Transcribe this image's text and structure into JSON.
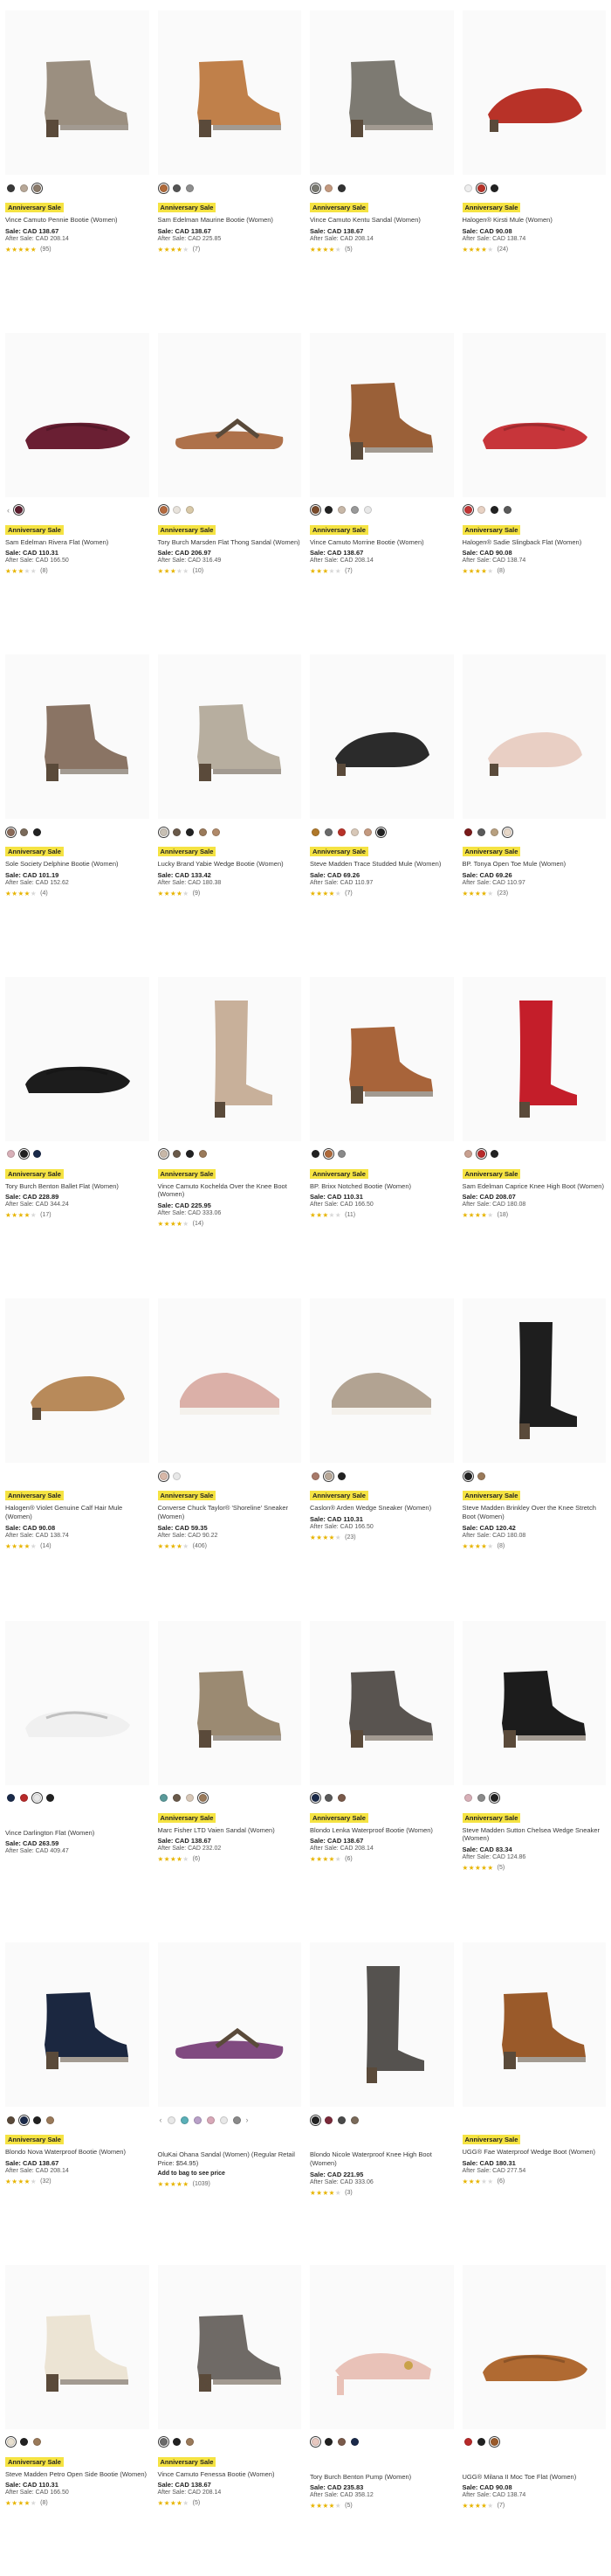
{
  "colors": {
    "accent_badge": "#f5e342",
    "star": "#e7b400"
  },
  "products": [
    {
      "badge": "Anniversary Sale",
      "title": "Vince Camuto Pennie Bootie (Women)",
      "sale": "Sale: CAD 138.67",
      "after": "After Sale: CAD 208.14",
      "rating": 5,
      "reviews": "(95)",
      "swatches": [
        "#3a3a3a",
        "#b8a898",
        "#8a7a6a"
      ],
      "selected": 2,
      "shape": "bootie",
      "color": "#9b8f80"
    },
    {
      "badge": "Anniversary Sale",
      "title": "Sam Edelman Maurine Bootie (Women)",
      "sale": "Sale: CAD 138.67",
      "after": "After Sale: CAD 225.85",
      "rating": 4,
      "reviews": "(7)",
      "swatches": [
        "#b06a3a",
        "#555555",
        "#8f8f8f"
      ],
      "selected": 0,
      "shape": "bootie",
      "color": "#c0804a"
    },
    {
      "badge": "Anniversary Sale",
      "title": "Vince Camuto Kentu Sandal (Women)",
      "sale": "Sale: CAD 138.67",
      "after": "After Sale: CAD 208.14",
      "rating": 4,
      "reviews": "(5)",
      "swatches": [
        "#7a7a72",
        "#c49a80",
        "#333333"
      ],
      "selected": 0,
      "shape": "bootie",
      "color": "#7d7a72"
    },
    {
      "badge": "Anniversary Sale",
      "title": "Halogen® Kirsti Mule (Women)",
      "sale": "Sale: CAD 90.08",
      "after": "After Sale: CAD 138.74",
      "rating": 4,
      "reviews": "(24)",
      "swatches": [
        "#eeeeee",
        "#b83228",
        "#222222"
      ],
      "selected": 1,
      "shape": "mule",
      "color": "#b83228"
    },
    {
      "badge": "Anniversary Sale",
      "title": "Sam Edelman Rivera Flat (Women)",
      "sale": "Sale: CAD 110.31",
      "after": "After Sale: CAD 166.50",
      "rating": 3,
      "reviews": "(8)",
      "swatches": [
        "#5c1d2e"
      ],
      "selected": 0,
      "shape": "flat",
      "color": "#6a1f33",
      "prev": true
    },
    {
      "badge": "Anniversary Sale",
      "title": "Tory Burch Marsden Flat Thong Sandal (Women)",
      "sale": "Sale: CAD 206.97",
      "after": "After Sale: CAD 316.49",
      "rating": 3,
      "reviews": "(10)",
      "swatches": [
        "#b56a3e",
        "#e8e3dc",
        "#d9c9a8"
      ],
      "selected": 0,
      "shape": "sandal",
      "color": "#a0582a"
    },
    {
      "badge": "Anniversary Sale",
      "title": "Vince Camuto Morrine Bootie (Women)",
      "sale": "Sale: CAD 138.67",
      "after": "After Sale: CAD 208.14",
      "rating": 3,
      "reviews": "(7)",
      "swatches": [
        "#7a4a2a",
        "#222222",
        "#c8b8a8",
        "#999999",
        "#e8e8e8"
      ],
      "selected": 0,
      "shape": "bootie",
      "color": "#9a6038"
    },
    {
      "badge": "Anniversary Sale",
      "title": "Halogen® Sadie Slingback Flat (Women)",
      "sale": "Sale: CAD 90.08",
      "after": "After Sale: CAD 138.74",
      "rating": 4,
      "reviews": "(8)",
      "swatches": [
        "#c23434",
        "#e8d2c4",
        "#222222",
        "#5a5a5a"
      ],
      "selected": 0,
      "shape": "flat",
      "color": "#c7353a"
    },
    {
      "badge": "Anniversary Sale",
      "title": "Sole Society Delphine Bootie (Women)",
      "sale": "Sale: CAD 101.19",
      "after": "After Sale: CAD 152.62",
      "rating": 4,
      "reviews": "(4)",
      "swatches": [
        "#8a6a58",
        "#7a6a5a",
        "#222222"
      ],
      "selected": 0,
      "shape": "bootie",
      "color": "#8a7464"
    },
    {
      "badge": "Anniversary Sale",
      "title": "Lucky Brand Yabie Wedge Bootie (Women)",
      "sale": "Sale: CAD 133.42",
      "after": "After Sale: CAD 180.38",
      "rating": 4,
      "reviews": "(9)",
      "swatches": [
        "#c8c0b4",
        "#6a5a4a",
        "#222222",
        "#9a7a5a",
        "#b08a6a"
      ],
      "selected": 0,
      "shape": "bootie",
      "color": "#b7ae9f"
    },
    {
      "badge": "Anniversary Sale",
      "title": "Steve Madden Trace Studded Mule (Women)",
      "sale": "Sale: CAD 69.26",
      "after": "After Sale: CAD 110.97",
      "rating": 4,
      "reviews": "(7)",
      "swatches": [
        "#b0782a",
        "#6a6a6a",
        "#b83228",
        "#d8c8b8",
        "#c49a80",
        "#222222"
      ],
      "selected": 5,
      "shape": "mule",
      "color": "#2b2b2b"
    },
    {
      "badge": "Anniversary Sale",
      "title": "BP. Tonya Open Toe Mule (Women)",
      "sale": "Sale: CAD 69.26",
      "after": "After Sale: CAD 110.97",
      "rating": 4,
      "reviews": "(23)",
      "swatches": [
        "#7a1a1a",
        "#5a5a5a",
        "#b8a080",
        "#e8d8c8"
      ],
      "selected": 3,
      "shape": "mule",
      "color": "#e9cfc4"
    },
    {
      "badge": "Anniversary Sale",
      "title": "Tory Burch Benton Ballet Flat (Women)",
      "sale": "Sale: CAD 228.89",
      "after": "After Sale: CAD 344.24",
      "rating": 4,
      "reviews": "(17)",
      "swatches": [
        "#d8b0b8",
        "#222222",
        "#1a2a4a"
      ],
      "selected": 1,
      "shape": "flat",
      "color": "#1c1c1c"
    },
    {
      "badge": "Anniversary Sale",
      "title": "Vince Camuto Kochelda Over the Knee Boot (Women)",
      "sale": "Sale: CAD 225.95",
      "after": "After Sale: CAD 333.06",
      "rating": 4,
      "reviews": "(14)",
      "swatches": [
        "#c8b8a8",
        "#6a5a4a",
        "#222222",
        "#9a7a5a"
      ],
      "selected": 0,
      "shape": "tallboot",
      "color": "#c8b09a"
    },
    {
      "badge": "Anniversary Sale",
      "title": "BP. Brixx Notched Bootie (Women)",
      "sale": "Sale: CAD 110.31",
      "after": "After Sale: CAD 166.50",
      "rating": 3,
      "reviews": "(11)",
      "swatches": [
        "#222222",
        "#b06a3a",
        "#8a8a8a"
      ],
      "selected": 1,
      "shape": "bootie",
      "color": "#a8643a"
    },
    {
      "badge": "Anniversary Sale",
      "title": "Sam Edelman Caprice Knee High Boot (Women)",
      "sale": "Sale: CAD 208.07",
      "after": "After Sale: CAD 180.08",
      "rating": 4,
      "reviews": "(18)",
      "swatches": [
        "#c8a090",
        "#b82a2a",
        "#222222"
      ],
      "selected": 1,
      "shape": "tallboot",
      "color": "#c41e2a"
    },
    {
      "badge": "Anniversary Sale",
      "title": "Halogen® Violet Genuine Calf Hair Mule (Women)",
      "sale": "Sale: CAD 90.08",
      "after": "After Sale: CAD 138.74",
      "rating": 4,
      "reviews": "(14)",
      "swatches": [],
      "selected": -1,
      "shape": "mule",
      "color": "#b88a5a"
    },
    {
      "badge": "Anniversary Sale",
      "title": "Converse Chuck Taylor® 'Shoreline' Sneaker (Women)",
      "sale": "Sale: CAD 59.35",
      "after": "After Sale: CAD 90.22",
      "rating": 4,
      "reviews": "(406)",
      "swatches": [
        "#d8b8a8",
        "#e8e8e8"
      ],
      "selected": 0,
      "shape": "sneaker",
      "color": "#dbb0a8"
    },
    {
      "badge": "Anniversary Sale",
      "title": "Caslon® Arden Wedge Sneaker (Women)",
      "sale": "Sale: CAD 110.31",
      "after": "After Sale: CAD 166.50",
      "rating": 4,
      "reviews": "(23)",
      "swatches": [
        "#a87a6a",
        "#b8a898",
        "#222222"
      ],
      "selected": 1,
      "shape": "sneaker",
      "color": "#b2a392"
    },
    {
      "badge": "Anniversary Sale",
      "title": "Steve Madden Brinkley Over the Knee Stretch Boot (Women)",
      "sale": "Sale: CAD 120.42",
      "after": "After Sale: CAD 180.08",
      "rating": 4,
      "reviews": "(8)",
      "swatches": [
        "#222222",
        "#9a7a5a"
      ],
      "selected": 0,
      "shape": "tallboot",
      "color": "#1e1e1e"
    },
    {
      "badge": "",
      "title": "Vince Darlington Flat (Women)",
      "sale": "Sale: CAD 263.59",
      "after": "After Sale: CAD 409.47",
      "rating": 0,
      "reviews": "",
      "swatches": [
        "#1a2a4a",
        "#b82a2a",
        "#e8e8e8",
        "#222222"
      ],
      "selected": 2,
      "shape": "flat",
      "color": "#f0f0f0"
    },
    {
      "badge": "Anniversary Sale",
      "title": "Marc Fisher LTD Vaien Sandal (Women)",
      "sale": "Sale: CAD 138.67",
      "after": "After Sale: CAD 232.02",
      "rating": 4,
      "reviews": "(6)",
      "swatches": [
        "#5a9a9a",
        "#6a5a4a",
        "#d8c8b8",
        "#9a7a5a"
      ],
      "selected": 3,
      "shape": "bootie",
      "color": "#9b8a72"
    },
    {
      "badge": "Anniversary Sale",
      "title": "Blondo Lenka Waterproof Bootie (Women)",
      "sale": "Sale: CAD 138.67",
      "after": "After Sale: CAD 208.14",
      "rating": 4,
      "reviews": "(6)",
      "swatches": [
        "#1a2a4a",
        "#5a5a5a",
        "#7a5a4a"
      ],
      "selected": 0,
      "shape": "bootie",
      "color": "#595450"
    },
    {
      "badge": "Anniversary Sale",
      "title": "Steve Madden Sutton Chelsea Wedge Sneaker (Women)",
      "sale": "Sale: CAD 83.34",
      "after": "After Sale: CAD 124.86",
      "rating": 5,
      "reviews": "(5)",
      "swatches": [
        "#d8b0b8",
        "#8a8a8a",
        "#222222"
      ],
      "selected": 2,
      "shape": "bootie",
      "color": "#1c1c1c"
    },
    {
      "badge": "Anniversary Sale",
      "title": "Blondo Nova Waterproof Bootie (Women)",
      "sale": "Sale: CAD 138.67",
      "after": "After Sale: CAD 208.14",
      "rating": 4,
      "reviews": "(32)",
      "swatches": [
        "#5a4a3a",
        "#1a2a4a",
        "#222222",
        "#9a7a5a"
      ],
      "selected": 1,
      "shape": "bootie",
      "color": "#1b2740"
    },
    {
      "badge": "",
      "title": "OluKai Ohana Sandal (Women) (Regular Retail Price: $54.95)",
      "sale": "",
      "after": "",
      "note": "Add to bag to see price",
      "rating": 5,
      "reviews": "(1039)",
      "swatches": [
        "#e8e8e8",
        "#5ab0b8",
        "#b8a0c8",
        "#d8a8b8",
        "#e8e8e8",
        "#8a8a8a"
      ],
      "selected": -1,
      "shape": "sandal",
      "color": "#6a2a6a",
      "prev": true,
      "next": true
    },
    {
      "badge": "",
      "title": "Blondo Nicole Waterproof Knee High Boot (Women)",
      "sale": "Sale: CAD 221.95",
      "after": "After Sale: CAD 333.06",
      "rating": 4,
      "reviews": "(3)",
      "swatches": [
        "#222222",
        "#7a2a3a",
        "#4a4a4a",
        "#7a6a5a"
      ],
      "selected": 0,
      "shape": "tallboot",
      "color": "#55524f"
    },
    {
      "badge": "Anniversary Sale",
      "title": "UGG® Fae Waterproof Wedge Boot (Women)",
      "sale": "Sale: CAD 180.31",
      "after": "After Sale: CAD 277.54",
      "rating": 3,
      "reviews": "(6)",
      "swatches": [],
      "selected": -1,
      "shape": "bootie",
      "color": "#9a5a2a"
    },
    {
      "badge": "Anniversary Sale",
      "title": "Steve Madden Petro Open Side Bootie (Women)",
      "sale": "Sale: CAD 110.31",
      "after": "After Sale: CAD 166.50",
      "rating": 4,
      "reviews": "(8)",
      "swatches": [
        "#e8e0d0",
        "#222222",
        "#9a7a5a"
      ],
      "selected": 0,
      "shape": "bootie",
      "color": "#ece4d4"
    },
    {
      "badge": "Anniversary Sale",
      "title": "Vince Camuto Fenessa Bootie (Women)",
      "sale": "Sale: CAD 138.67",
      "after": "After Sale: CAD 208.14",
      "rating": 4,
      "reviews": "(5)",
      "swatches": [
        "#6a6a6a",
        "#222222",
        "#9a7a5a"
      ],
      "selected": 0,
      "shape": "bootie",
      "color": "#6f6a66"
    },
    {
      "badge": "",
      "title": "Tory Burch Benton Pump (Women)",
      "sale": "Sale: CAD 235.83",
      "after": "After Sale: CAD 358.12",
      "rating": 4,
      "reviews": "(5)",
      "swatches": [
        "#e8c8c0",
        "#222222",
        "#7a5a4a",
        "#1a2a4a"
      ],
      "selected": 0,
      "shape": "pump",
      "color": "#e9c2b8"
    },
    {
      "badge": "",
      "title": "UGG® Milana II Moc Toe Flat (Women)",
      "sale": "Sale: CAD 90.08",
      "after": "After Sale: CAD 138.74",
      "rating": 4,
      "reviews": "(7)",
      "swatches": [
        "#b82a2a",
        "#222222",
        "#9a5a2a"
      ],
      "selected": 2,
      "shape": "flat",
      "color": "#b06a32"
    }
  ]
}
